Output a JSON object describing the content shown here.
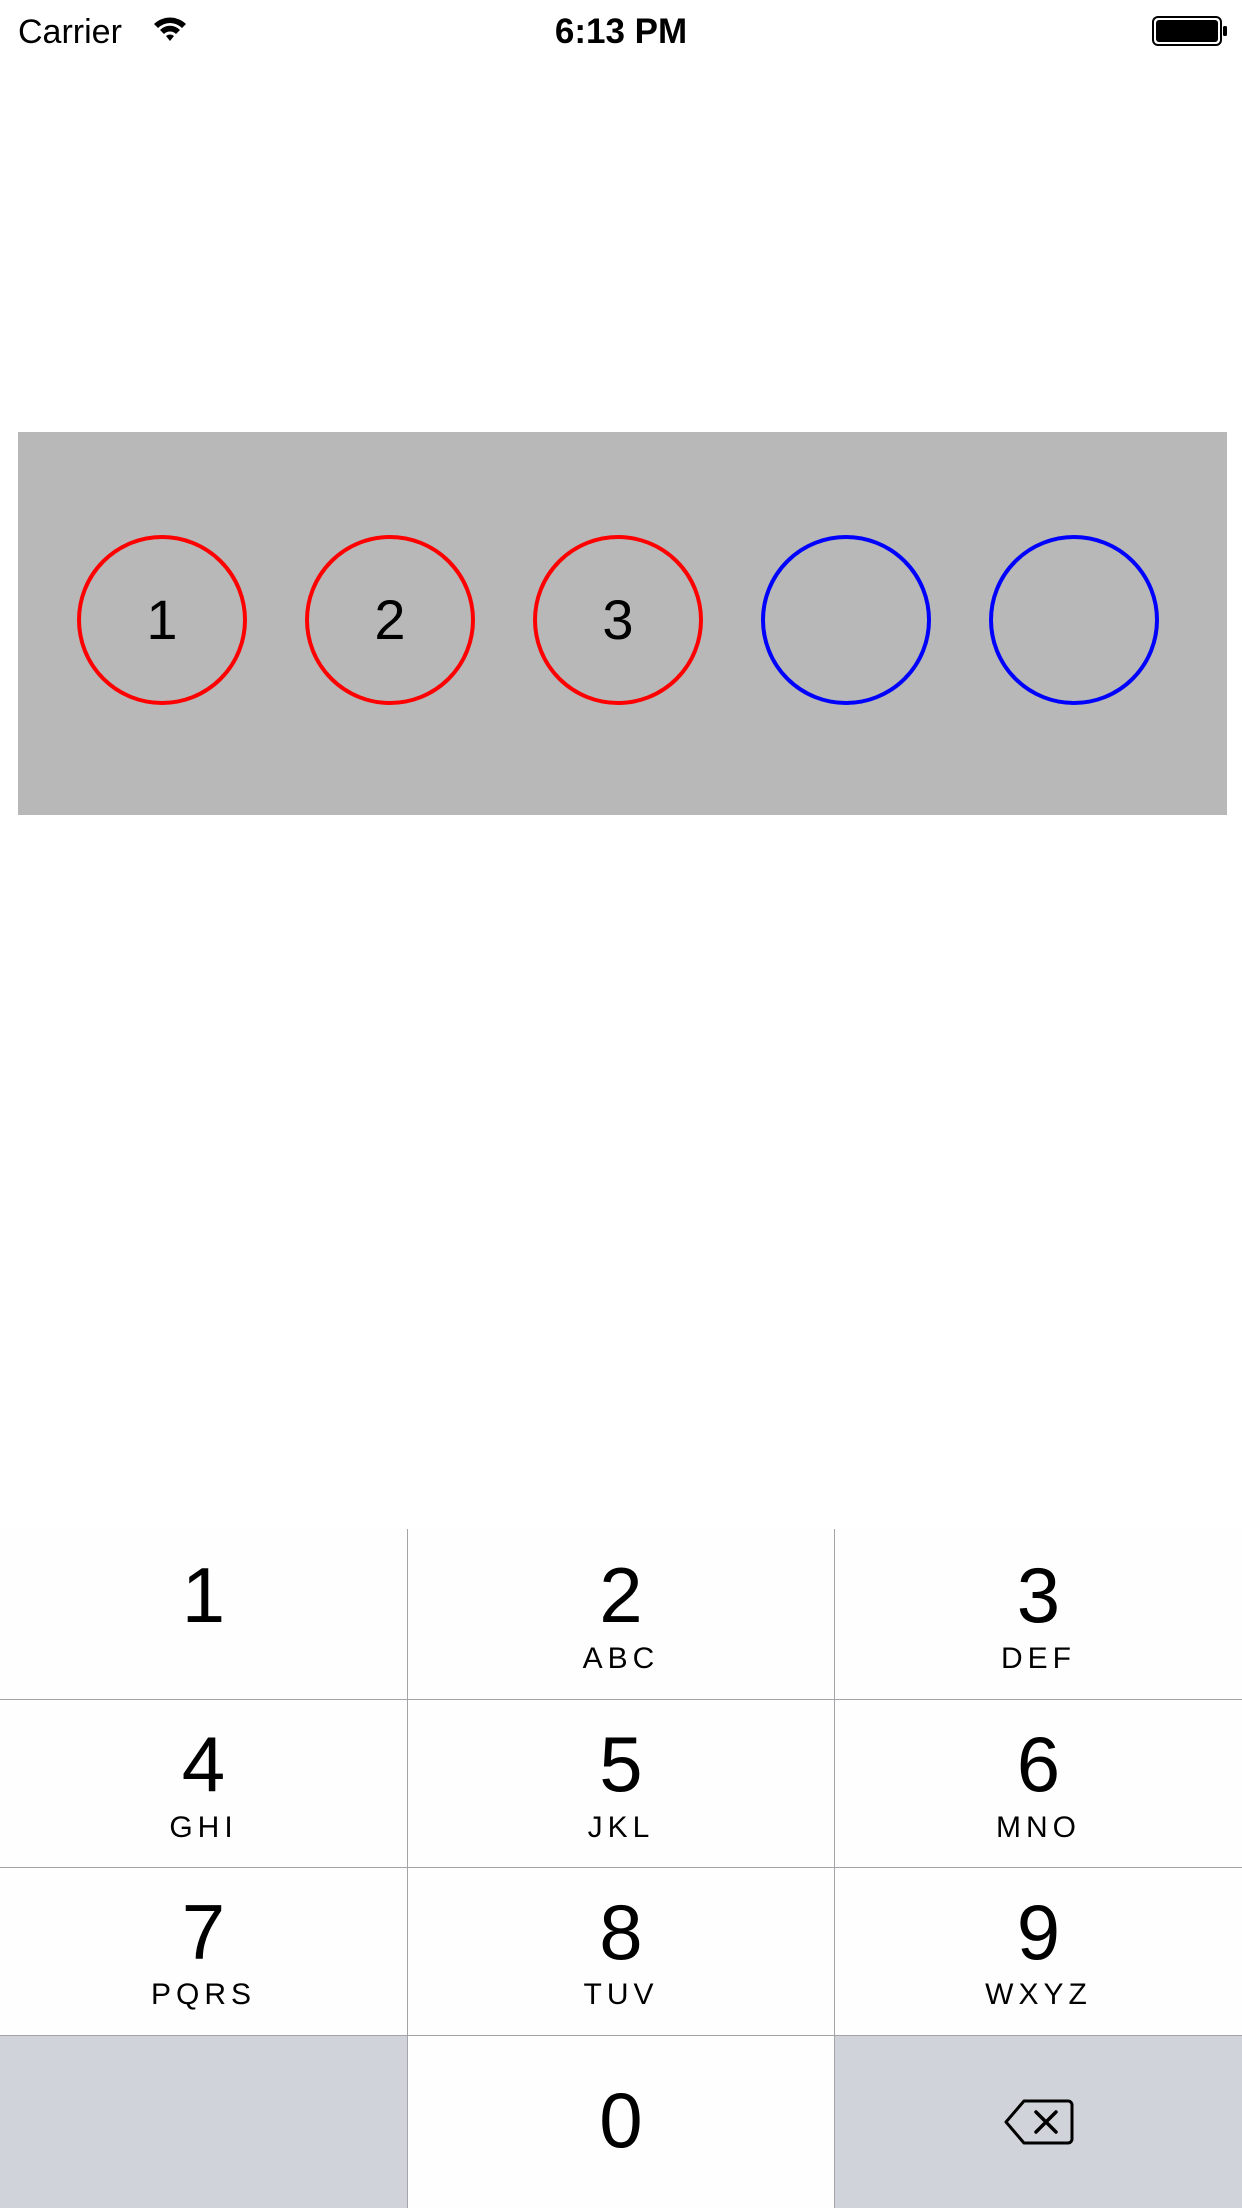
{
  "status_bar": {
    "carrier": "Carrier",
    "time": "6:13 PM",
    "wifi_icon": "wifi-icon",
    "battery_icon": "battery-icon"
  },
  "code_panel": {
    "background": "#b8b8b8",
    "filled_color": "#ff0000",
    "empty_color": "#0000ff",
    "slots": [
      {
        "digit": "1",
        "state": "filled"
      },
      {
        "digit": "2",
        "state": "filled"
      },
      {
        "digit": "3",
        "state": "filled"
      },
      {
        "digit": "",
        "state": "empty"
      },
      {
        "digit": "",
        "state": "empty"
      }
    ]
  },
  "keypad": {
    "key_color": "#fefefe",
    "function_key_color": "#d0d3da",
    "keys": [
      {
        "digit": "1",
        "letters": ""
      },
      {
        "digit": "2",
        "letters": "ABC"
      },
      {
        "digit": "3",
        "letters": "DEF"
      },
      {
        "digit": "4",
        "letters": "GHI"
      },
      {
        "digit": "5",
        "letters": "JKL"
      },
      {
        "digit": "6",
        "letters": "MNO"
      },
      {
        "digit": "7",
        "letters": "PQRS"
      },
      {
        "digit": "8",
        "letters": "TUV"
      },
      {
        "digit": "9",
        "letters": "WXYZ"
      },
      {
        "digit": "0",
        "letters": ""
      }
    ],
    "delete_icon": "delete-backspace-icon"
  }
}
